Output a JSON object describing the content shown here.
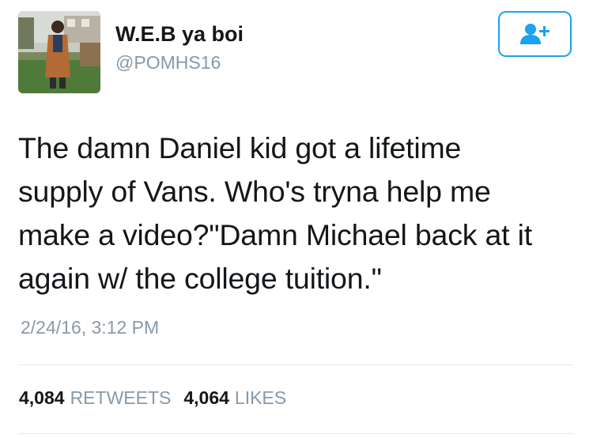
{
  "user": {
    "name": "W.E.B ya boi",
    "handle": "@POMHS16"
  },
  "tweet": {
    "text": "The damn Daniel kid got a lifetime\nsupply of Vans. Who's tryna help me\nmake a video?\"Damn Michael back at it\nagain w/ the college tuition.\"",
    "timestamp": "2/24/16, 3:12 PM"
  },
  "stats": {
    "retweets_count": "4,084",
    "retweets_label": "RETWEETS",
    "likes_count": "4,064",
    "likes_label": "LIKES"
  },
  "icons": {
    "follow": "add-user-icon"
  },
  "colors": {
    "accent": "#1da1f2",
    "text": "#14171a",
    "muted": "#8899a6",
    "divider": "#e1e8ed"
  }
}
